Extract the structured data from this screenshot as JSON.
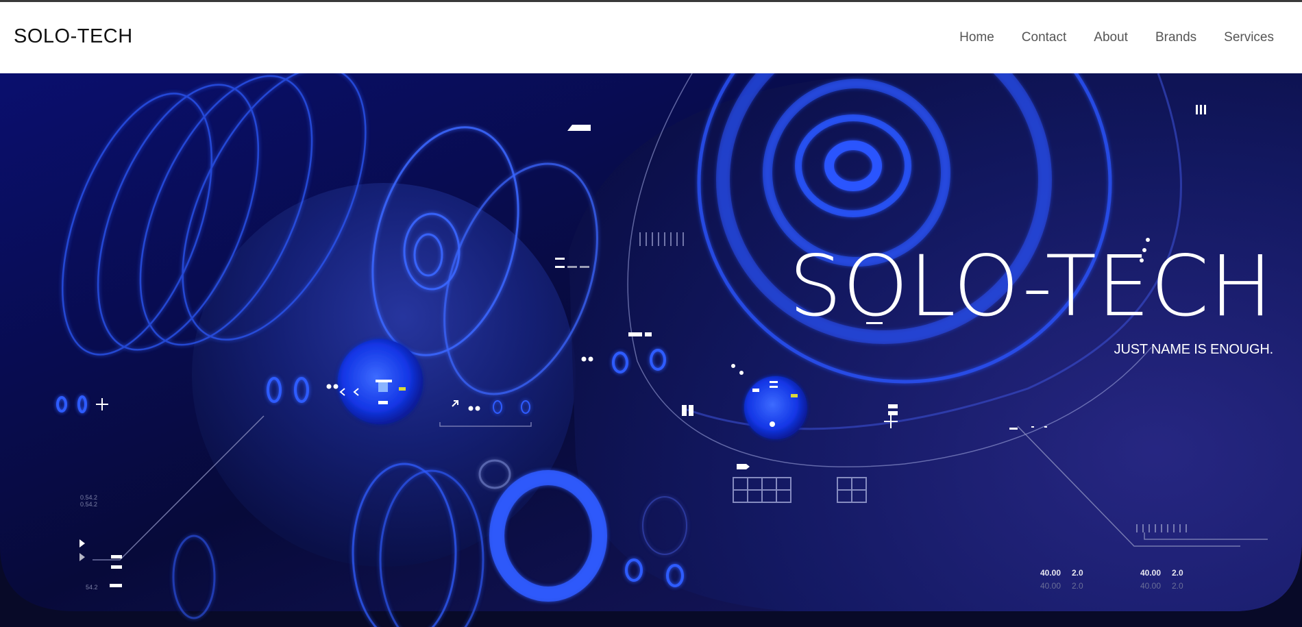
{
  "navbar": {
    "brand": "SOLO-TECH",
    "links": [
      "Home",
      "Contact",
      "About",
      "Brands",
      "Services"
    ]
  },
  "hero": {
    "title": "SOLO-TECH",
    "subtitle": "JUST NAME IS ENOUGH."
  },
  "hud": {
    "left_code_1": "0.54.2",
    "left_code_2": "0.54.2",
    "left_code_3": "54.2",
    "stat_a_1": "40.00",
    "stat_a_2": "2.0",
    "stat_a_3": "40.00",
    "stat_a_4": "2.0",
    "stat_b_1": "40.00",
    "stat_b_2": "2.0",
    "stat_b_3": "40.00",
    "stat_b_4": "2.0"
  },
  "colors": {
    "accent_blue": "#1f3cff",
    "hero_bg": "#080a28",
    "nav_bg": "#ffffff"
  }
}
